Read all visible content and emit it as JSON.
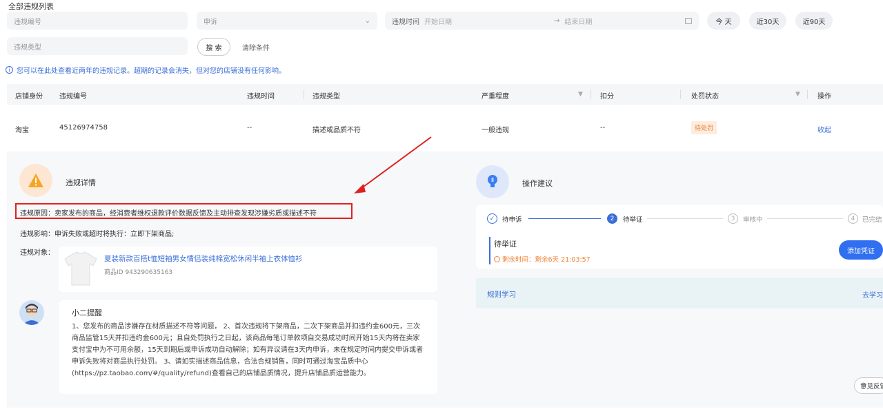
{
  "page": {
    "title": "全部违规列表"
  },
  "filters": {
    "violation_no_placeholder": "违规编号",
    "appeal_select": "申诉",
    "time_label": "违规时间",
    "start_placeholder": "开始日期",
    "end_placeholder": "结束日期",
    "today": "今 天",
    "last30": "近30天",
    "last90": "近90天",
    "type_placeholder": "违规类型",
    "search": "搜 索",
    "clear": "清除条件"
  },
  "notice": "您可以在此处查看近两年的违规记录。超期的记录会消失，但对您的店铺没有任何影响。",
  "table": {
    "headers": [
      "店铺身份",
      "违规编号",
      "违规时间",
      "违规类型",
      "严重程度",
      "扣分",
      "处罚状态",
      "操作"
    ],
    "row": {
      "shop": "淘宝",
      "no": "45126974758",
      "time": "--",
      "type": "描述或品质不符",
      "severity": "一般违规",
      "points": "--",
      "status": "待处罚",
      "action": "收起"
    }
  },
  "detail": {
    "title": "违规详情",
    "reason_label": "违规原因：",
    "reason_text": "卖家发布的商品，经消费者维权退款评价数据反馈及主动排查发现涉嫌劣质或描述不符",
    "impact": "违规影响：申诉失败或超时将执行：立即下架商品;",
    "target_label": "违规对象：",
    "product_title": "夏装新款百搭t恤短袖男女情侣装纯棉宽松休闲半袖上衣体恤衫",
    "product_id": "商品ID 943290635163"
  },
  "reminder": {
    "title": "小二提醒",
    "body": "1、您发布的商品涉嫌存在材质描述不符等问题， 2、首次违规将下架商品，二次下架商品并扣违约金600元，三次商品监管15天并扣违约金600元；且自处罚执行之日起，该商品每笔订单款项自交易成功时间开始15天内将在卖家支付宝中为不可用余额，15天到期后或申诉成功自动解除；如有异议请在3天内申诉，未在规定时间内提交申诉或者申诉失败将对商品执行处罚。 3、请如实描述商品信息，合法合规销售，同时可通过淘宝品质中心(https://pz.taobao.com/#/quality/refund)查看自己的店铺品质情况，提升店铺品质运营能力。"
  },
  "advice": {
    "title": "操作建议",
    "steps": [
      "待申诉",
      "待举证",
      "审核中",
      "已完结"
    ],
    "step_numbers": [
      "2",
      "3",
      "4"
    ],
    "current_title": "待举证",
    "countdown": "剩余时间：剩余6天 21:03:57",
    "add_evidence": "添加凭证",
    "rule_study": "规则学习",
    "go_study": "去学习"
  },
  "feedback": "意见反馈",
  "colors": {
    "accent": "#3a6fd8",
    "warning": "#f08232",
    "highlight_border": "#e02020",
    "primary_button": "#2f6ff0"
  }
}
